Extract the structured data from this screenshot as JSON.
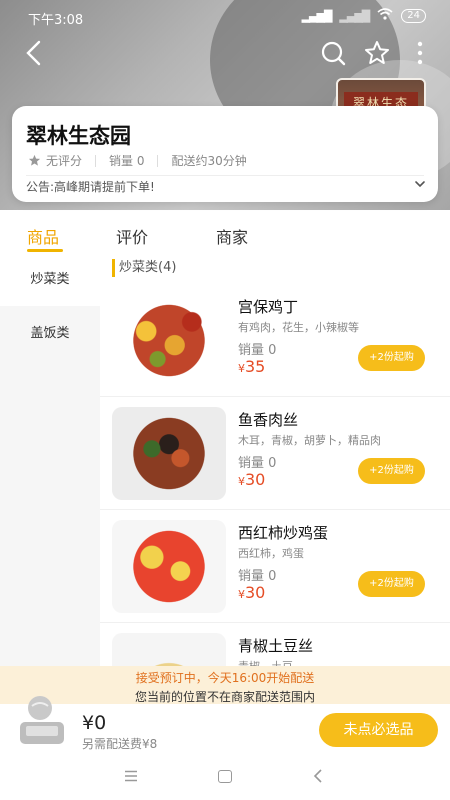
{
  "status": {
    "time": "下午3:08",
    "signal": "4G",
    "battery": "24"
  },
  "shop": {
    "name": "翠林生态园",
    "photo_sign": "翠林生态",
    "rating_label": "无评分",
    "sales_label": "销量 0",
    "delivery_label": "配送约30分钟",
    "notice": "公告:高峰期请提前下单!"
  },
  "tabs": [
    {
      "label": "商品"
    },
    {
      "label": "评价"
    },
    {
      "label": "商家"
    }
  ],
  "sidebar": {
    "items": [
      {
        "label": "炒菜类"
      },
      {
        "label": "盖饭类"
      }
    ]
  },
  "category": {
    "title": "炒菜类(4)"
  },
  "items": [
    {
      "name": "宫保鸡丁",
      "desc": "有鸡肉，花生，小辣椒等",
      "sales": "销量 0",
      "currency": "¥",
      "price": "35",
      "button": "+2份起购",
      "image": "kungpao-chicken"
    },
    {
      "name": "鱼香肉丝",
      "desc": "木耳，青椒，胡萝卜，精品肉",
      "sales": "销量 0",
      "currency": "¥",
      "price": "30",
      "button": "+2份起购",
      "image": "yuxiang-pork"
    },
    {
      "name": "西红柿炒鸡蛋",
      "desc": "西红柿，鸡蛋",
      "sales": "销量 0",
      "currency": "¥",
      "price": "30",
      "button": "+2份起购",
      "image": "tomato-egg"
    },
    {
      "name": "青椒土豆丝",
      "desc": "青椒，土豆",
      "sales": "",
      "currency": "",
      "price": "",
      "button": "",
      "image": "potato-shreds"
    }
  ],
  "preorder": {
    "line1": "接受预订中，今天16:00开始配送",
    "line2": "您当前的位置不在商家配送范围内"
  },
  "cart": {
    "total": "¥0",
    "delivery_fee": "另需配送费¥8",
    "checkout": "未点必选品"
  },
  "colors": {
    "accent": "#f6bd1a",
    "price": "#e54d26",
    "active_tab": "#f0a500"
  }
}
